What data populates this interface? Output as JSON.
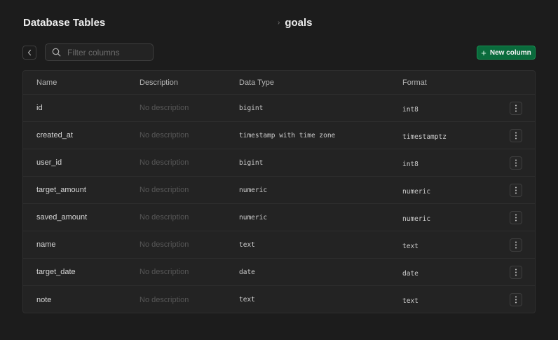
{
  "header": {
    "title": "Database Tables",
    "breadcrumb_separator": "›",
    "breadcrumb_table": "goals"
  },
  "toolbar": {
    "search_placeholder": "Filter columns",
    "search_value": "",
    "new_column_label": "New column"
  },
  "colors": {
    "background": "#1c1c1c",
    "panel": "#232323",
    "border": "#2e2e2e",
    "accent_green": "#0a6b3c",
    "muted_text": "#575757"
  },
  "icons": {
    "back": "chevron-left-icon",
    "search": "search-icon",
    "new_column": "plus-icon",
    "row_actions": "more-vertical-icon"
  },
  "table": {
    "columns": [
      "Name",
      "Description",
      "Data Type",
      "Format"
    ],
    "rows": [
      {
        "name": "id",
        "description": "No description",
        "data_type": "bigint",
        "format": "int8"
      },
      {
        "name": "created_at",
        "description": "No description",
        "data_type": "timestamp with time zone",
        "format": "timestamptz"
      },
      {
        "name": "user_id",
        "description": "No description",
        "data_type": "bigint",
        "format": "int8"
      },
      {
        "name": "target_amount",
        "description": "No description",
        "data_type": "numeric",
        "format": "numeric"
      },
      {
        "name": "saved_amount",
        "description": "No description",
        "data_type": "numeric",
        "format": "numeric"
      },
      {
        "name": "name",
        "description": "No description",
        "data_type": "text",
        "format": "text"
      },
      {
        "name": "target_date",
        "description": "No description",
        "data_type": "date",
        "format": "date"
      },
      {
        "name": "note",
        "description": "No description",
        "data_type": "text",
        "format": "text"
      }
    ]
  }
}
